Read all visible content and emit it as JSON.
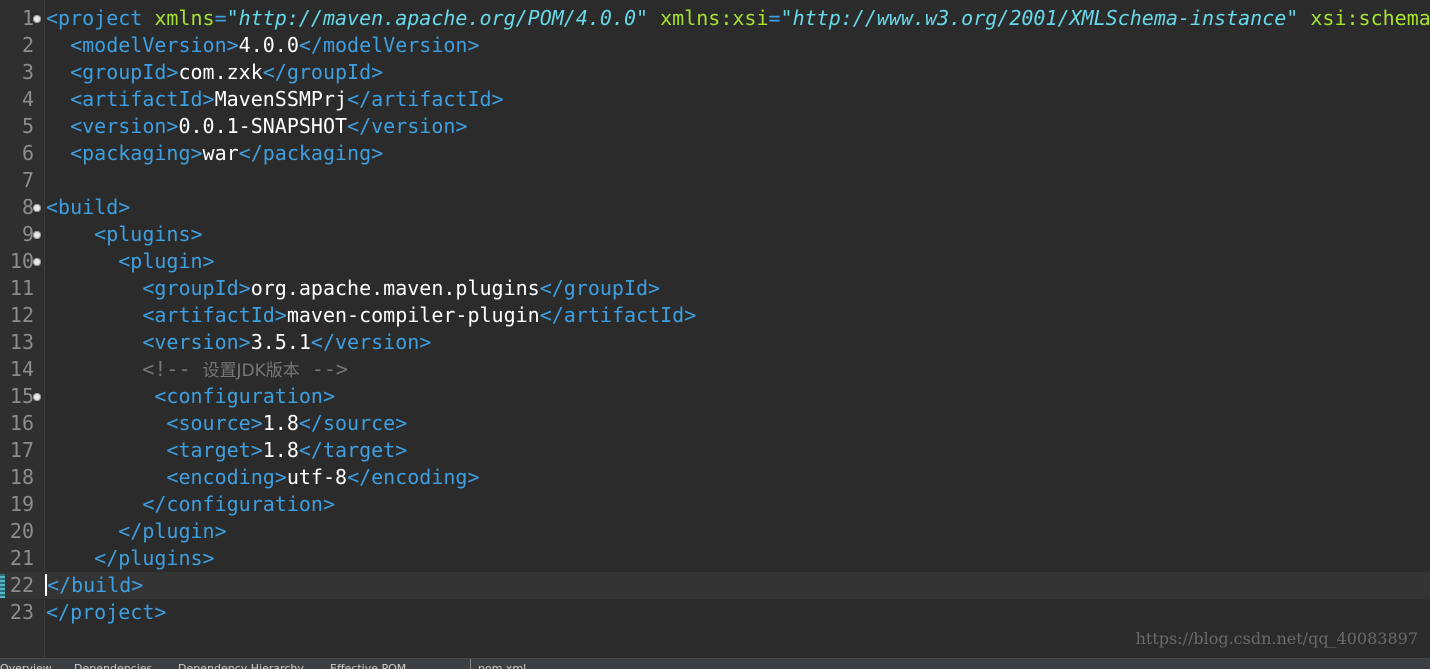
{
  "editor": {
    "current_line": 22,
    "lines": [
      {
        "n": "1",
        "fold": true,
        "tokens": [
          [
            "tag",
            "<project "
          ],
          [
            "attr",
            "xmlns"
          ],
          [
            "tag",
            "="
          ],
          [
            "val",
            "\"http://maven.apache.org/POM/4.0.0\""
          ],
          [
            "txt",
            " "
          ],
          [
            "attr",
            "xmlns:xsi"
          ],
          [
            "tag",
            "="
          ],
          [
            "val",
            "\"http://www.w3.org/2001/XMLSchema-instance\""
          ],
          [
            "txt",
            " "
          ],
          [
            "attr",
            "xsi:schemaLocation"
          ]
        ]
      },
      {
        "n": "2",
        "tokens": [
          [
            "txt",
            "  "
          ],
          [
            "tag",
            "<modelVersion>"
          ],
          [
            "txt",
            "4.0.0"
          ],
          [
            "tag",
            "</modelVersion>"
          ]
        ]
      },
      {
        "n": "3",
        "tokens": [
          [
            "txt",
            "  "
          ],
          [
            "tag",
            "<groupId>"
          ],
          [
            "txt",
            "com.zxk"
          ],
          [
            "tag",
            "</groupId>"
          ]
        ]
      },
      {
        "n": "4",
        "tokens": [
          [
            "txt",
            "  "
          ],
          [
            "tag",
            "<artifactId>"
          ],
          [
            "txt",
            "MavenSSMPrj"
          ],
          [
            "tag",
            "</artifactId>"
          ]
        ]
      },
      {
        "n": "5",
        "tokens": [
          [
            "txt",
            "  "
          ],
          [
            "tag",
            "<version>"
          ],
          [
            "txt",
            "0.0.1-SNAPSHOT"
          ],
          [
            "tag",
            "</version>"
          ]
        ]
      },
      {
        "n": "6",
        "tokens": [
          [
            "txt",
            "  "
          ],
          [
            "tag",
            "<packaging>"
          ],
          [
            "txt",
            "war"
          ],
          [
            "tag",
            "</packaging>"
          ]
        ]
      },
      {
        "n": "7",
        "tokens": []
      },
      {
        "n": "8",
        "fold": true,
        "tokens": [
          [
            "tag",
            "<build>"
          ]
        ]
      },
      {
        "n": "9",
        "fold": true,
        "tokens": [
          [
            "txt",
            "    "
          ],
          [
            "tag",
            "<plugins>"
          ]
        ]
      },
      {
        "n": "10",
        "fold": true,
        "tokens": [
          [
            "txt",
            "      "
          ],
          [
            "tag",
            "<plugin>"
          ]
        ]
      },
      {
        "n": "11",
        "tokens": [
          [
            "txt",
            "        "
          ],
          [
            "tag",
            "<groupId>"
          ],
          [
            "txt",
            "org.apache.maven.plugins"
          ],
          [
            "tag",
            "</groupId>"
          ]
        ]
      },
      {
        "n": "12",
        "tokens": [
          [
            "txt",
            "        "
          ],
          [
            "tag",
            "<artifactId>"
          ],
          [
            "txt",
            "maven-compiler-plugin"
          ],
          [
            "tag",
            "</artifactId>"
          ]
        ]
      },
      {
        "n": "13",
        "tokens": [
          [
            "txt",
            "        "
          ],
          [
            "tag",
            "<version>"
          ],
          [
            "txt",
            "3.5.1"
          ],
          [
            "tag",
            "</version>"
          ]
        ]
      },
      {
        "n": "14",
        "tokens": [
          [
            "txt",
            "        "
          ],
          [
            "cmt",
            "<!-- "
          ],
          [
            "cmt-cjk",
            "设置JDK版本"
          ],
          [
            "cmt",
            " -->"
          ]
        ]
      },
      {
        "n": "15",
        "fold": true,
        "tokens": [
          [
            "txt",
            "         "
          ],
          [
            "tag",
            "<configuration>"
          ]
        ]
      },
      {
        "n": "16",
        "tokens": [
          [
            "txt",
            "          "
          ],
          [
            "tag",
            "<source>"
          ],
          [
            "txt",
            "1.8"
          ],
          [
            "tag",
            "</source>"
          ]
        ]
      },
      {
        "n": "17",
        "tokens": [
          [
            "txt",
            "          "
          ],
          [
            "tag",
            "<target>"
          ],
          [
            "txt",
            "1.8"
          ],
          [
            "tag",
            "</target>"
          ]
        ]
      },
      {
        "n": "18",
        "tokens": [
          [
            "txt",
            "          "
          ],
          [
            "tag",
            "<encoding>"
          ],
          [
            "txt",
            "utf-8"
          ],
          [
            "tag",
            "</encoding>"
          ]
        ]
      },
      {
        "n": "19",
        "tokens": [
          [
            "txt",
            "        "
          ],
          [
            "tag",
            "</configuration>"
          ]
        ]
      },
      {
        "n": "20",
        "tokens": [
          [
            "txt",
            "      "
          ],
          [
            "tag",
            "</plugin>"
          ]
        ]
      },
      {
        "n": "21",
        "tokens": [
          [
            "txt",
            "    "
          ],
          [
            "tag",
            "</plugins>"
          ]
        ]
      },
      {
        "n": "22",
        "cursor": true,
        "tokens": [
          [
            "tag",
            "</build>"
          ]
        ]
      },
      {
        "n": "23",
        "tokens": [
          [
            "tag",
            "</project>"
          ]
        ]
      }
    ]
  },
  "watermark": "https://blog.csdn.net/qq_40083897",
  "bottom_tabs": [
    "Overview",
    "Dependencies",
    "Dependency Hierarchy",
    "Effective POM",
    "pom.xml"
  ]
}
